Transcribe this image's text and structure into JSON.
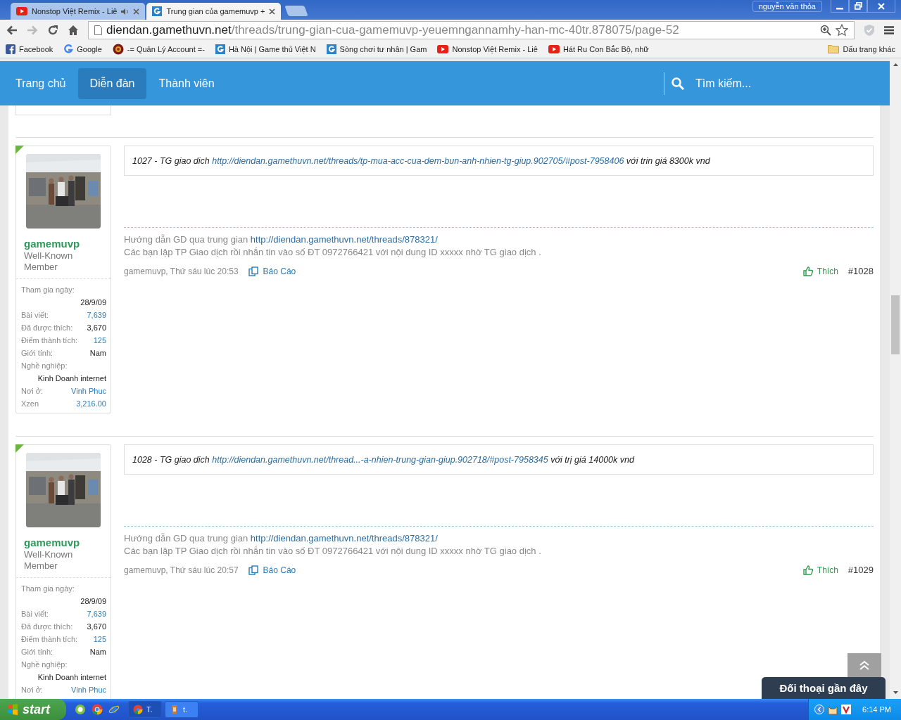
{
  "browser": {
    "tabs": [
      {
        "title": "Nonstop Việt Remix - Liê",
        "kind": "youtube",
        "audio": true,
        "selected": false
      },
      {
        "title": "Trung gian của gamemuvp +",
        "kind": "site",
        "audio": false,
        "selected": true
      }
    ],
    "profile": "nguyễn văn thỏa",
    "address": {
      "host": "diendan.gamethuvn.net",
      "path": "/threads/trung-gian-cua-gamemuvp-yeuemngannamhy-han-mc-40tr.878075/page-52"
    },
    "bookmarks": [
      {
        "label": "Facebook",
        "kind": "facebook"
      },
      {
        "label": "Google",
        "kind": "google"
      },
      {
        "label": "-= Quản Lý Account =-",
        "kind": "game"
      },
      {
        "label": "Hà Nội | Game thủ Việt N",
        "kind": "site"
      },
      {
        "label": "Sòng chơi tư nhân | Gam",
        "kind": "site"
      },
      {
        "label": "Nonstop Việt Remix - Liê",
        "kind": "youtube"
      },
      {
        "label": "Hát Ru Con Bắc Bộ, nhữ",
        "kind": "youtube"
      }
    ],
    "other_bookmarks": "Dấu trang khác"
  },
  "site_nav": {
    "items": [
      {
        "label": "Trang chủ",
        "selected": false
      },
      {
        "label": "Diễn đàn",
        "selected": true
      },
      {
        "label": "Thành viên",
        "selected": false
      }
    ],
    "search": {
      "placeholder": "Tìm kiếm..."
    }
  },
  "posts": [
    {
      "author": "gamemuvp",
      "user_title": "Well-Known Member",
      "stats": [
        {
          "label": "Tham gia ngày:",
          "value": "28/9/09",
          "kind": "stacked",
          "link": false
        },
        {
          "label": "Bài viết:",
          "value": "7,639",
          "kind": "inline",
          "link": true
        },
        {
          "label": "Đã được thích:",
          "value": "3,670",
          "kind": "inline",
          "link": false
        },
        {
          "label": "Điểm thành tích:",
          "value": "125",
          "kind": "inline",
          "link": true
        },
        {
          "label": "Giới tính:",
          "value": "Nam",
          "kind": "inline",
          "link": false
        },
        {
          "label": "Nghề nghiệp:",
          "value": "Kinh Doanh internet",
          "kind": "stacked",
          "link": false
        },
        {
          "label": "Nơi ở:",
          "value": "Vinh Phuc",
          "kind": "inline",
          "link": true
        },
        {
          "label": "Xzen",
          "value": "3,216.00",
          "kind": "inline",
          "link": true
        }
      ],
      "message": {
        "prefix": "1027 - TG giao dich ",
        "link": "http://diendan.gamethuvn.net/threads/tp-mua-acc-cua-dem-bun-anh-nhien-tg-giup.902705/#post-7958406",
        "suffix": " với trin giá 8300k vnd"
      },
      "signature": {
        "prefix": "Hướng dẫn GD qua trung gian ",
        "link": "http://diendan.gamethuvn.net/threads/878321/",
        "line2": "Các bạn lập TP Giao dịch rồi nhắn tin vào số ĐT 0972766421 với nội dung ID xxxxx nhờ TG giao dịch ."
      },
      "byline": "gamemuvp, Thứ sáu lúc 20:53",
      "report": "Báo Cáo",
      "like": "Thích",
      "number": "#1028"
    },
    {
      "author": "gamemuvp",
      "user_title": "Well-Known Member",
      "stats": [
        {
          "label": "Tham gia ngày:",
          "value": "28/9/09",
          "kind": "stacked",
          "link": false
        },
        {
          "label": "Bài viết:",
          "value": "7,639",
          "kind": "inline",
          "link": true
        },
        {
          "label": "Đã được thích:",
          "value": "3,670",
          "kind": "inline",
          "link": false
        },
        {
          "label": "Điểm thành tích:",
          "value": "125",
          "kind": "inline",
          "link": true
        },
        {
          "label": "Giới tính:",
          "value": "Nam",
          "kind": "inline",
          "link": false
        },
        {
          "label": "Nghề nghiệp:",
          "value": "Kinh Doanh internet",
          "kind": "stacked",
          "link": false
        },
        {
          "label": "Nơi ở:",
          "value": "Vinh Phuc",
          "kind": "inline",
          "link": true
        }
      ],
      "message": {
        "prefix": "1028 - TG giao dich ",
        "link": "http://diendan.gamethuvn.net/thread...-a-nhien-trung-gian-giup.902718/#post-7958345",
        "suffix": " với trị giá 14000k vnd"
      },
      "signature": {
        "prefix": "Hướng dẫn GD qua trung gian ",
        "link": "http://diendan.gamethuvn.net/threads/878321/",
        "line2": "Các bạn lập TP Giao dịch rồi nhắn tin vào số ĐT 0972766421 với nội dung ID xxxxx nhờ TG giao dịch ."
      },
      "byline": "gamemuvp, Thứ sáu lúc 20:57",
      "report": "Báo Cáo",
      "like": "Thích",
      "number": "#1029"
    }
  ],
  "chat_tab": "Đối thoại gần đây",
  "taskbar": {
    "start": "start",
    "tasks": [
      {
        "label": "T.",
        "kind": "chrome",
        "selected": true
      },
      {
        "label": "t.",
        "kind": "app",
        "selected": false
      }
    ],
    "clock": "6:14 PM"
  }
}
